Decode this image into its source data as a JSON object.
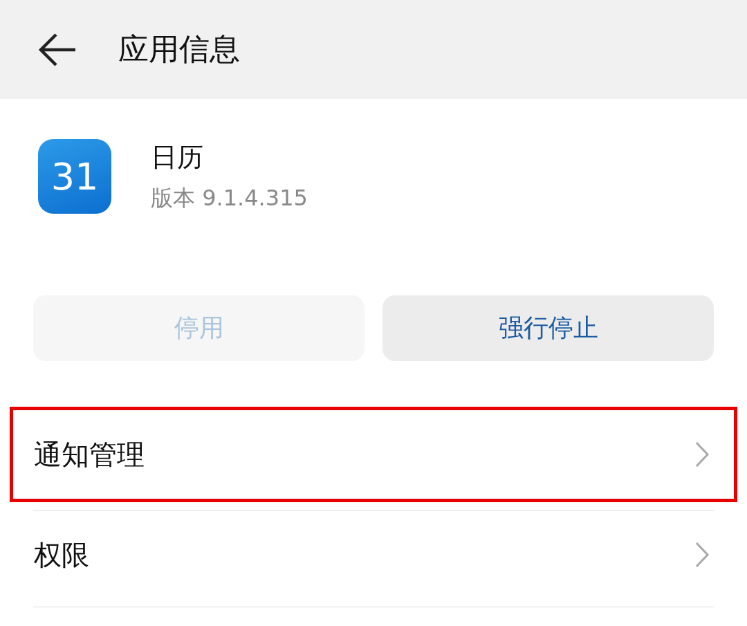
{
  "header": {
    "title": "应用信息"
  },
  "app": {
    "name": "日历",
    "icon_text": "31",
    "version": "版本 9.1.4.315"
  },
  "buttons": [
    {
      "label": "停用",
      "disabled": true
    },
    {
      "label": "强行停止",
      "disabled": false
    }
  ],
  "items": [
    {
      "label": "通知管理",
      "highlighted": true
    },
    {
      "label": "权限",
      "highlighted": false
    }
  ]
}
